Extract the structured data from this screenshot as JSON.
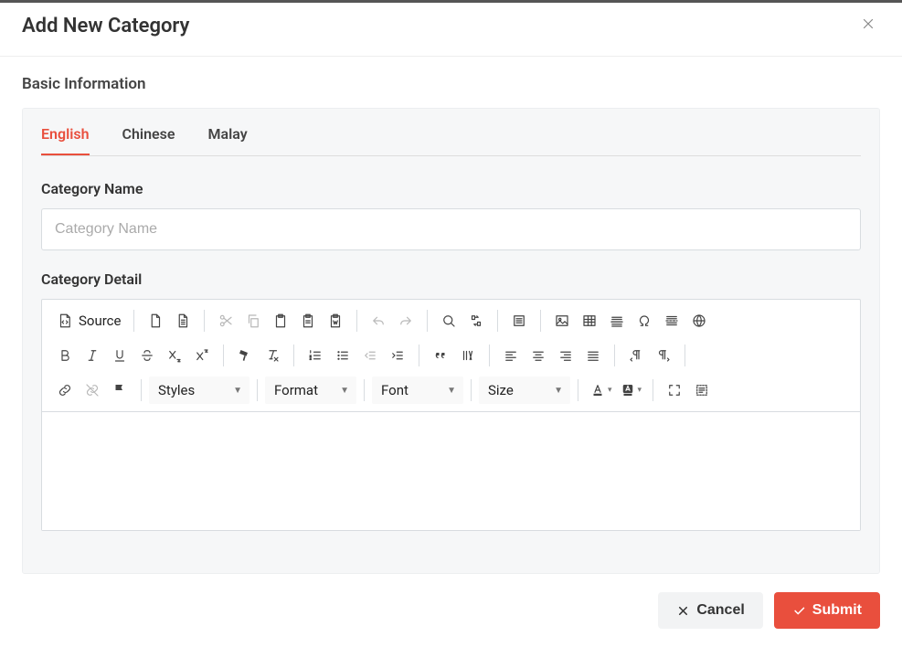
{
  "modal": {
    "title": "Add New Category",
    "section": "Basic Information"
  },
  "tabs": [
    {
      "label": "English",
      "active": true
    },
    {
      "label": "Chinese",
      "active": false
    },
    {
      "label": "Malay",
      "active": false
    }
  ],
  "form": {
    "name_label": "Category Name",
    "name_placeholder": "Category Name",
    "name_value": "",
    "detail_label": "Category Detail"
  },
  "editor": {
    "source_label": "Source",
    "combos": {
      "styles": "Styles",
      "format": "Format",
      "font": "Font",
      "size": "Size"
    }
  },
  "footer": {
    "cancel": "Cancel",
    "submit": "Submit"
  }
}
